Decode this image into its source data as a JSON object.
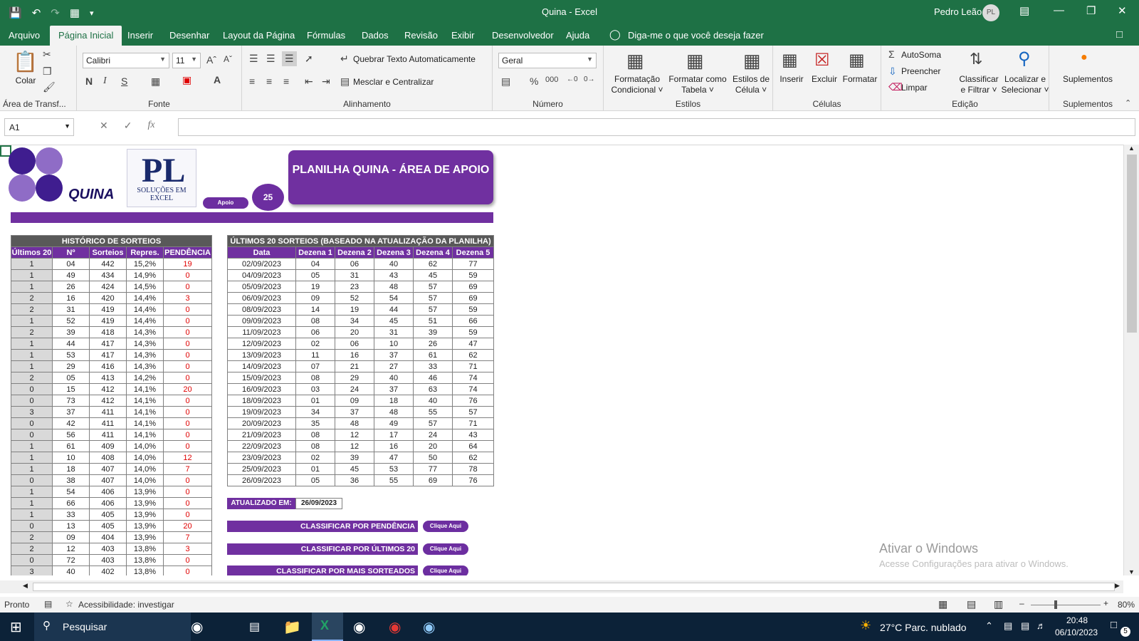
{
  "titlebar": {
    "title": "Quina  -  Excel",
    "user": "Pedro Leão",
    "avatar": "PL"
  },
  "tabs": [
    "Arquivo",
    "Página Inicial",
    "Inserir",
    "Desenhar",
    "Layout da Página",
    "Fórmulas",
    "Dados",
    "Revisão",
    "Exibir",
    "Desenvolvedor",
    "Ajuda"
  ],
  "tell_me": "Diga-me o que você deseja fazer",
  "ribbon": {
    "clipboard": {
      "paste": "Colar",
      "label": "Área de Transf..."
    },
    "font": {
      "name": "Calibri",
      "size": "11",
      "bold": "N",
      "italic": "I",
      "underline": "S",
      "label": "Fonte"
    },
    "alignment": {
      "wrap": "Quebrar Texto Automaticamente",
      "merge": "Mesclar e Centralizar",
      "label": "Alinhamento"
    },
    "number": {
      "format": "Geral",
      "percent": "%",
      "thousands": "000",
      "label": "Número"
    },
    "styles": {
      "cond1": "Formatação",
      "cond2": "Condicional",
      "table1": "Formatar como",
      "table2": "Tabela",
      "cell1": "Estilos de",
      "cell2": "Célula",
      "label": "Estilos"
    },
    "cells": {
      "insert": "Inserir",
      "delete": "Excluir",
      "format": "Formatar",
      "label": "Células"
    },
    "editing": {
      "autosum": "AutoSoma",
      "fill": "Preencher",
      "clear": "Limpar",
      "sort1": "Classificar",
      "sort2": "e Filtrar",
      "find1": "Localizar e",
      "find2": "Selecionar",
      "label": "Edição"
    },
    "addins": {
      "btn": "Suplementos",
      "label": "Suplementos"
    }
  },
  "formula_bar": {
    "name_box": "A1",
    "fx": "fx"
  },
  "sheet": {
    "quina_word": "QUINA",
    "pl_logo": "PL",
    "pl_sub": "SOLUÇÕES EM EXCEL",
    "apoio_btn": "Apoio",
    "circle_value": "25",
    "banner": "PLANILHA QUINA - ÁREA DE APOIO",
    "hist": {
      "title": "HISTÓRICO DE SORTEIOS",
      "headers": [
        "Últimos 20",
        "Nº",
        "Sorteios",
        "Repres.",
        "PENDÊNCIA"
      ],
      "rows": [
        [
          "1",
          "04",
          "442",
          "15,2%",
          "19"
        ],
        [
          "1",
          "49",
          "434",
          "14,9%",
          "0"
        ],
        [
          "1",
          "26",
          "424",
          "14,5%",
          "0"
        ],
        [
          "2",
          "16",
          "420",
          "14,4%",
          "3"
        ],
        [
          "2",
          "31",
          "419",
          "14,4%",
          "0"
        ],
        [
          "1",
          "52",
          "419",
          "14,4%",
          "0"
        ],
        [
          "2",
          "39",
          "418",
          "14,3%",
          "0"
        ],
        [
          "1",
          "44",
          "417",
          "14,3%",
          "0"
        ],
        [
          "1",
          "53",
          "417",
          "14,3%",
          "0"
        ],
        [
          "1",
          "29",
          "416",
          "14,3%",
          "0"
        ],
        [
          "2",
          "05",
          "413",
          "14,2%",
          "0"
        ],
        [
          "0",
          "15",
          "412",
          "14,1%",
          "20"
        ],
        [
          "0",
          "73",
          "412",
          "14,1%",
          "0"
        ],
        [
          "3",
          "37",
          "411",
          "14,1%",
          "0"
        ],
        [
          "0",
          "42",
          "411",
          "14,1%",
          "0"
        ],
        [
          "0",
          "56",
          "411",
          "14,1%",
          "0"
        ],
        [
          "1",
          "61",
          "409",
          "14,0%",
          "0"
        ],
        [
          "1",
          "10",
          "408",
          "14,0%",
          "12"
        ],
        [
          "1",
          "18",
          "407",
          "14,0%",
          "7"
        ],
        [
          "0",
          "38",
          "407",
          "14,0%",
          "0"
        ],
        [
          "1",
          "54",
          "406",
          "13,9%",
          "0"
        ],
        [
          "1",
          "66",
          "406",
          "13,9%",
          "0"
        ],
        [
          "1",
          "33",
          "405",
          "13,9%",
          "0"
        ],
        [
          "0",
          "13",
          "405",
          "13,9%",
          "20"
        ],
        [
          "2",
          "09",
          "404",
          "13,9%",
          "7"
        ],
        [
          "2",
          "12",
          "403",
          "13,8%",
          "3"
        ],
        [
          "0",
          "72",
          "403",
          "13,8%",
          "0"
        ],
        [
          "3",
          "40",
          "402",
          "13,8%",
          "0"
        ]
      ]
    },
    "last20": {
      "title": "ÚLTIMOS 20 SORTEIOS (BASEADO NA ATUALIZAÇÃO DA PLANILHA)",
      "headers": [
        "Data",
        "Dezena 1",
        "Dezena 2",
        "Dezena 3",
        "Dezena 4",
        "Dezena 5"
      ],
      "rows": [
        [
          "02/09/2023",
          "04",
          "06",
          "40",
          "62",
          "77"
        ],
        [
          "04/09/2023",
          "05",
          "31",
          "43",
          "45",
          "59"
        ],
        [
          "05/09/2023",
          "19",
          "23",
          "48",
          "57",
          "69"
        ],
        [
          "06/09/2023",
          "09",
          "52",
          "54",
          "57",
          "69"
        ],
        [
          "08/09/2023",
          "14",
          "19",
          "44",
          "57",
          "59"
        ],
        [
          "09/09/2023",
          "08",
          "34",
          "45",
          "51",
          "66"
        ],
        [
          "11/09/2023",
          "06",
          "20",
          "31",
          "39",
          "59"
        ],
        [
          "12/09/2023",
          "02",
          "06",
          "10",
          "26",
          "47"
        ],
        [
          "13/09/2023",
          "11",
          "16",
          "37",
          "61",
          "62"
        ],
        [
          "14/09/2023",
          "07",
          "21",
          "27",
          "33",
          "71"
        ],
        [
          "15/09/2023",
          "08",
          "29",
          "40",
          "46",
          "74"
        ],
        [
          "16/09/2023",
          "03",
          "24",
          "37",
          "63",
          "74"
        ],
        [
          "18/09/2023",
          "01",
          "09",
          "18",
          "40",
          "76"
        ],
        [
          "19/09/2023",
          "34",
          "37",
          "48",
          "55",
          "57"
        ],
        [
          "20/09/2023",
          "35",
          "48",
          "49",
          "57",
          "71"
        ],
        [
          "21/09/2023",
          "08",
          "12",
          "17",
          "24",
          "43"
        ],
        [
          "22/09/2023",
          "08",
          "12",
          "16",
          "20",
          "64"
        ],
        [
          "23/09/2023",
          "02",
          "39",
          "47",
          "50",
          "62"
        ],
        [
          "25/09/2023",
          "01",
          "45",
          "53",
          "77",
          "78"
        ],
        [
          "26/09/2023",
          "05",
          "36",
          "55",
          "69",
          "76"
        ]
      ]
    },
    "updated_label": "ATUALIZADO EM:",
    "updated_value": "26/09/2023",
    "classify": [
      {
        "label": "CLASSIFICAR POR PENDÊNCIA",
        "btn": "Clique Aqui"
      },
      {
        "label": "CLASSIFICAR POR ÚLTIMOS 20",
        "btn": "Clique Aqui"
      },
      {
        "label": "CLASSIFICAR POR MAIS SORTEADOS",
        "btn": "Clique Aqui"
      }
    ],
    "activate_title": "Ativar o Windows",
    "activate_sub": "Acesse Configurações para ativar o Windows."
  },
  "status": {
    "ready": "Pronto",
    "accessibility": "Acessibilidade: investigar",
    "zoom": "80%"
  },
  "taskbar": {
    "search": "Pesquisar",
    "weather": "27°C  Parc. nublado",
    "time": "20:48",
    "date": "06/10/2023",
    "notif": "5"
  },
  "colors": {
    "excel_green": "#1e7145",
    "purple": "#7030a0",
    "header_gray": "#595959",
    "pending_red": "#e00000"
  }
}
